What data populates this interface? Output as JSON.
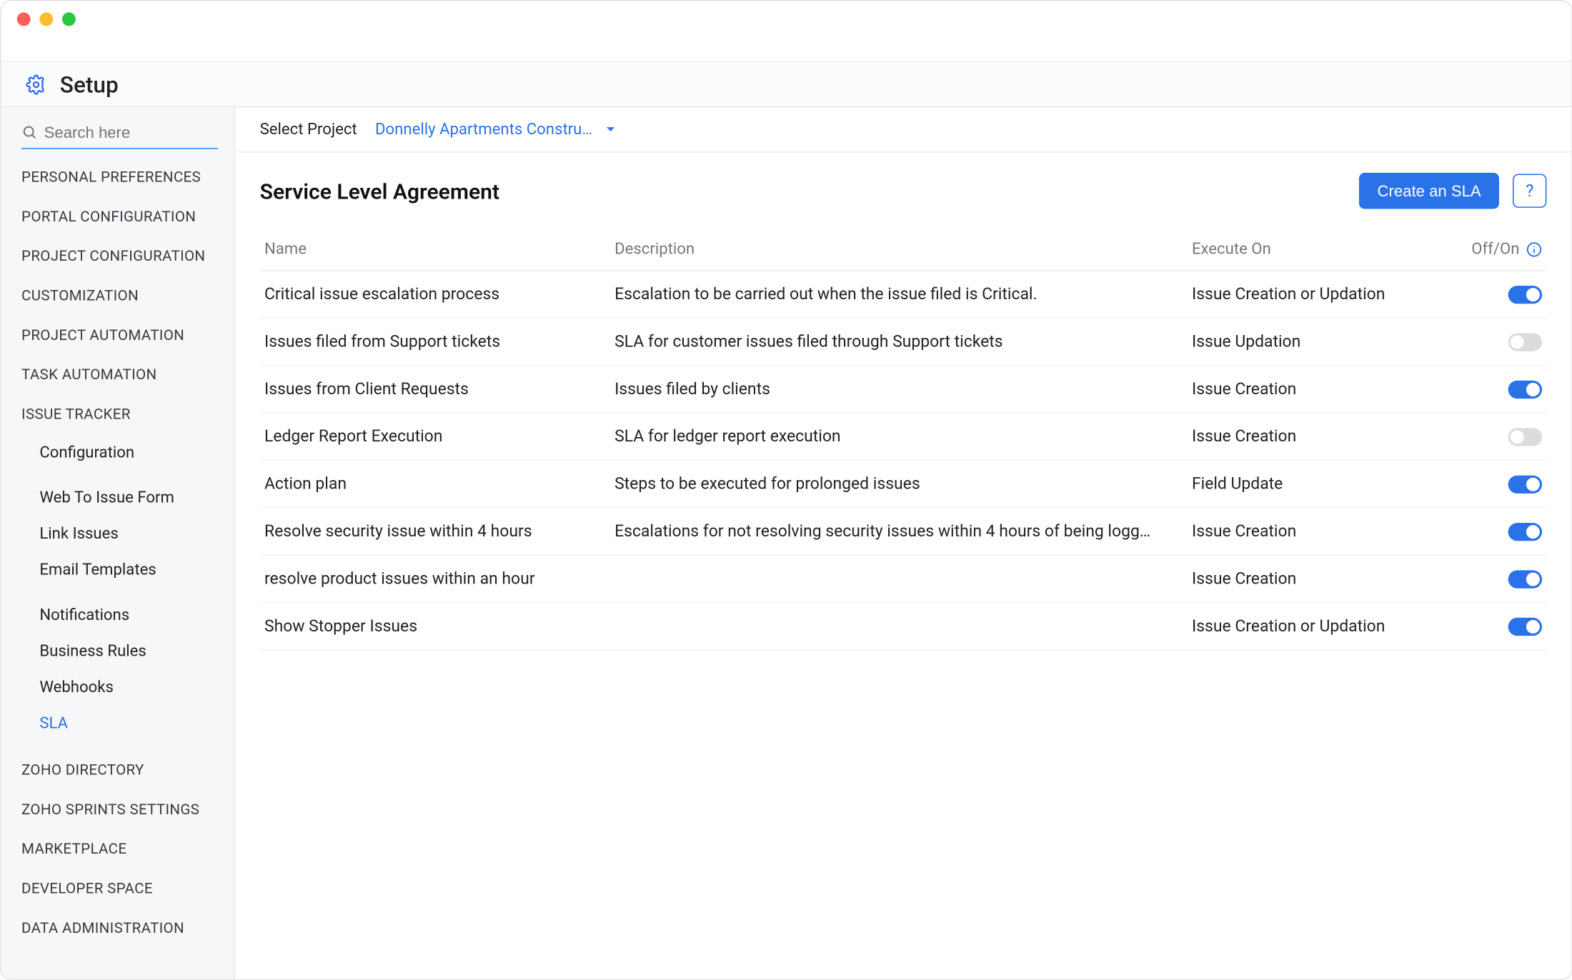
{
  "setup_title": "Setup",
  "search_placeholder": "Search here",
  "sidebar": {
    "sections_top": [
      "PERSONAL PREFERENCES",
      "PORTAL CONFIGURATION",
      "PROJECT CONFIGURATION",
      "CUSTOMIZATION",
      "PROJECT AUTOMATION",
      "TASK AUTOMATION",
      "ISSUE TRACKER"
    ],
    "issue_tracker_items_1": [
      "Configuration"
    ],
    "issue_tracker_items_2": [
      "Web To Issue Form",
      "Link Issues",
      "Email Templates"
    ],
    "issue_tracker_items_3": [
      "Notifications",
      "Business Rules",
      "Webhooks",
      "SLA"
    ],
    "sections_bottom": [
      "ZOHO DIRECTORY",
      "ZOHO SPRINTS SETTINGS",
      "MARKETPLACE",
      "DEVELOPER SPACE",
      "DATA ADMINISTRATION"
    ],
    "selected_sub": "SLA"
  },
  "project_bar": {
    "label": "Select Project",
    "value": "Donnelly Apartments Constru…"
  },
  "page": {
    "title": "Service Level Agreement",
    "create_btn": "Create an SLA",
    "help_btn": "?"
  },
  "table": {
    "headers": {
      "name": "Name",
      "description": "Description",
      "execute_on": "Execute On",
      "off_on": "Off/On"
    },
    "rows": [
      {
        "name": "Critical issue escalation process",
        "description": "Escalation to be carried out when the issue filed is Critical.",
        "execute_on": "Issue Creation or Updation",
        "on": true
      },
      {
        "name": "Issues filed from Support tickets",
        "description": "SLA for customer issues filed through Support tickets",
        "execute_on": "Issue Updation",
        "on": false
      },
      {
        "name": "Issues from Client Requests",
        "description": "Issues filed by clients",
        "execute_on": "Issue Creation",
        "on": true
      },
      {
        "name": "Ledger Report Execution",
        "description": "SLA for ledger report execution",
        "execute_on": "Issue Creation",
        "on": false
      },
      {
        "name": "Action plan",
        "description": "Steps to be executed for prolonged issues",
        "execute_on": "Field Update",
        "on": true
      },
      {
        "name": "Resolve security issue within 4 hours",
        "description": "Escalations for not resolving security issues within 4 hours of being logg…",
        "execute_on": "Issue Creation",
        "on": true
      },
      {
        "name": "resolve product issues within an hour",
        "description": "",
        "execute_on": "Issue Creation",
        "on": true
      },
      {
        "name": "Show Stopper Issues",
        "description": "",
        "execute_on": "Issue Creation or Updation",
        "on": true
      }
    ]
  }
}
